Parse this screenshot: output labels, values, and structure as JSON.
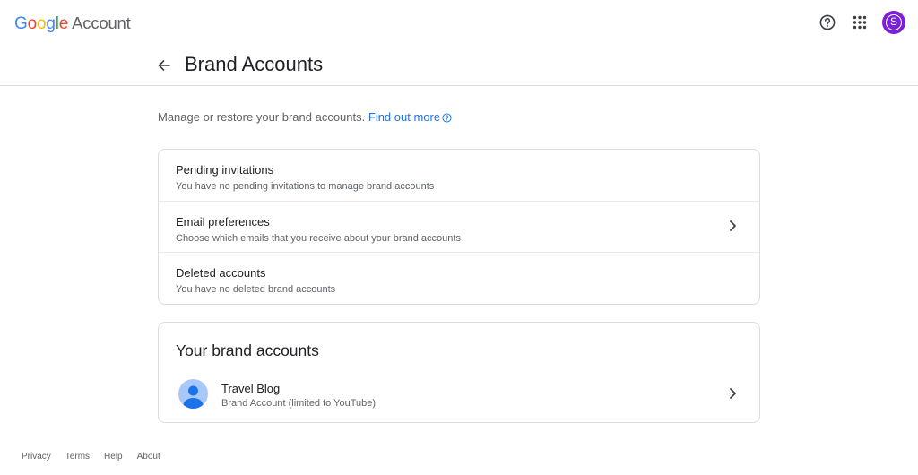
{
  "header": {
    "logo_google": "Google",
    "logo_account": "Account",
    "help_icon": "help-circle-icon",
    "apps_icon": "apps-grid-icon",
    "avatar_letter": "S",
    "avatar_color": "#7b1fd9"
  },
  "page": {
    "title": "Brand Accounts",
    "intro_text": "Manage or restore your brand accounts.",
    "intro_link": "Find out more"
  },
  "settings": {
    "rows": [
      {
        "title": "Pending invitations",
        "subtitle": "You have no pending invitations to manage brand accounts"
      },
      {
        "title": "Email preferences",
        "subtitle": "Choose which emails that you receive about your brand accounts"
      },
      {
        "title": "Deleted accounts",
        "subtitle": "You have no deleted brand accounts"
      }
    ]
  },
  "brand_accounts": {
    "heading": "Your brand accounts",
    "items": [
      {
        "name": "Travel Blog",
        "type": "Brand Account (limited to YouTube)"
      }
    ]
  },
  "footer": {
    "links": [
      "Privacy",
      "Terms",
      "Help",
      "About"
    ]
  },
  "colors": {
    "link": "#1a73e8",
    "border": "#dadce0",
    "text_secondary": "#5f6368"
  }
}
